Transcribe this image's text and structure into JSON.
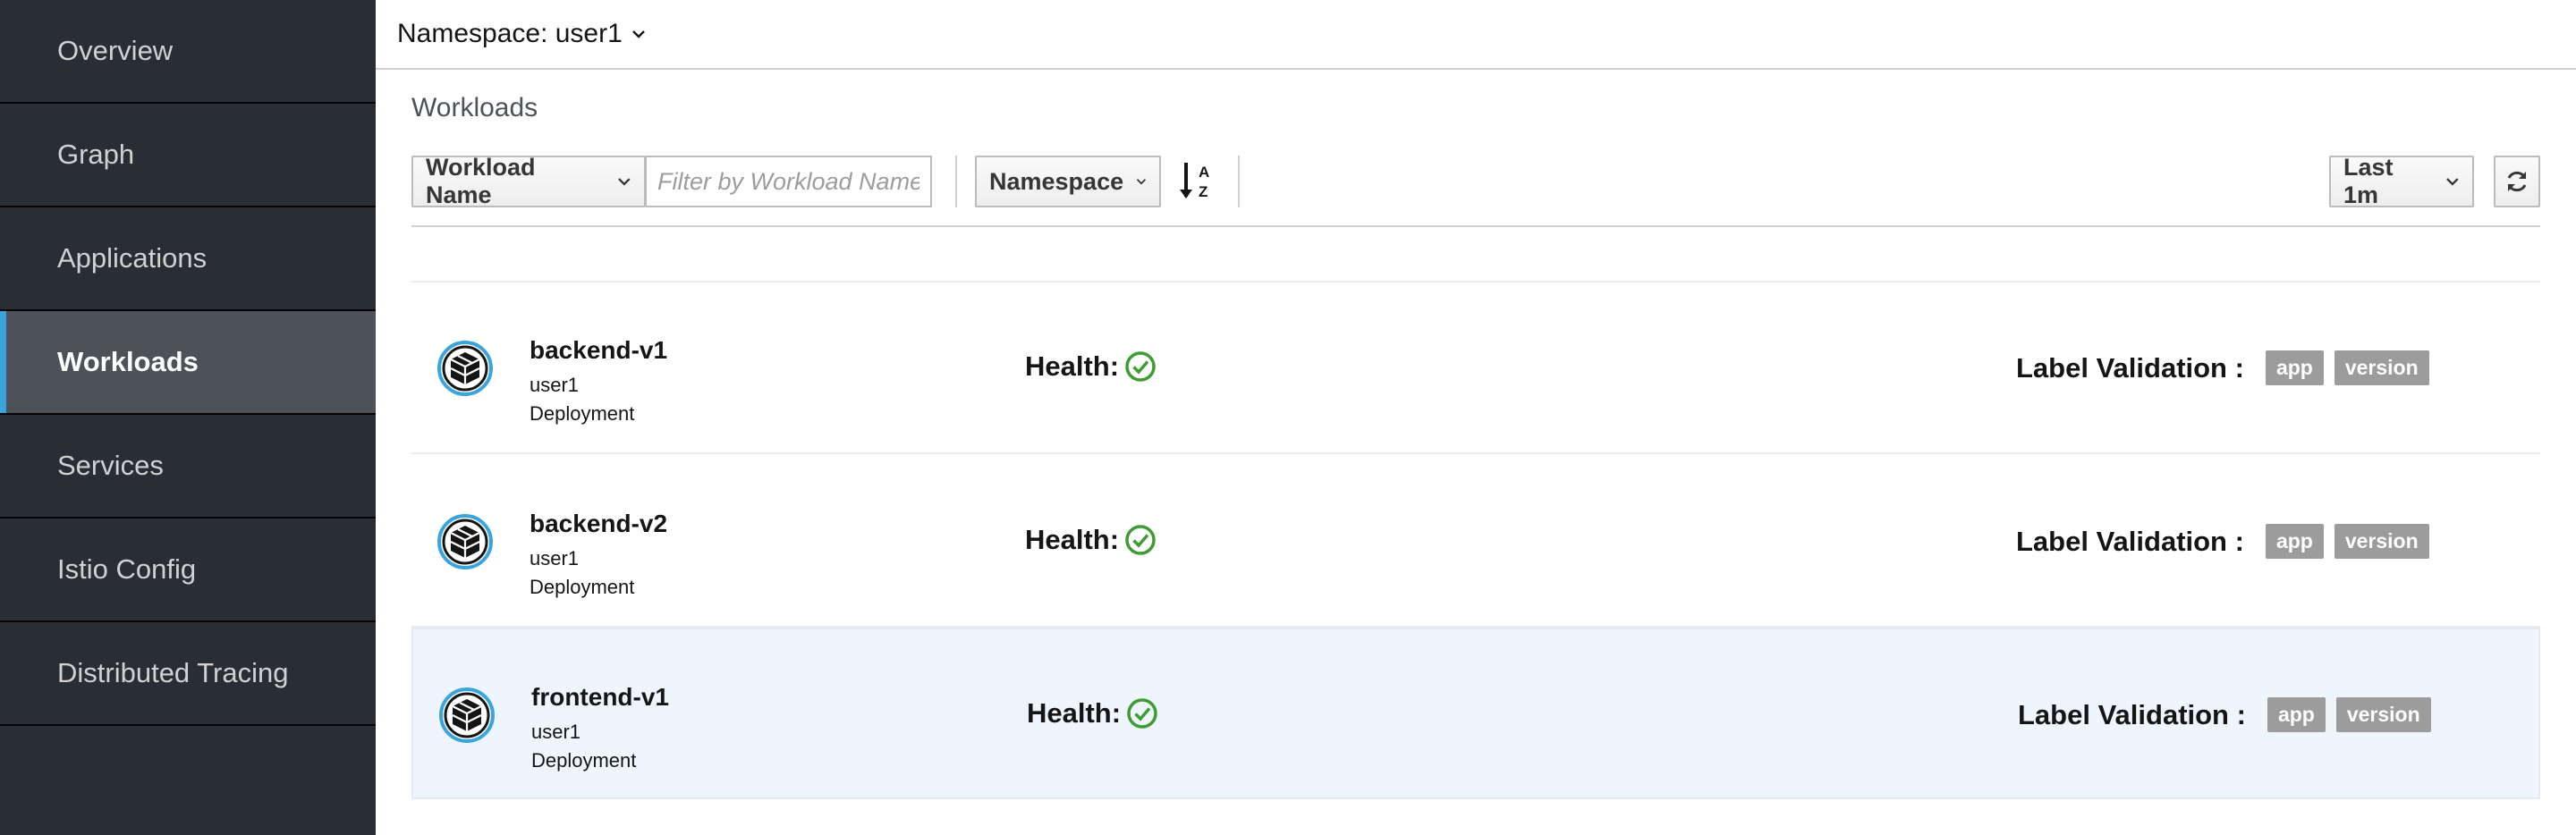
{
  "sidebar": {
    "items": [
      {
        "label": "Overview",
        "active": false
      },
      {
        "label": "Graph",
        "active": false
      },
      {
        "label": "Applications",
        "active": false
      },
      {
        "label": "Workloads",
        "active": true
      },
      {
        "label": "Services",
        "active": false
      },
      {
        "label": "Istio Config",
        "active": false
      },
      {
        "label": "Distributed Tracing",
        "active": false
      }
    ],
    "active_accent": "#39a5dc"
  },
  "namespace_selector": {
    "label": "Namespace: user1",
    "icon": "chevron-down-icon"
  },
  "page": {
    "title": "Workloads"
  },
  "toolbar": {
    "filter_type": "Workload Name",
    "filter_placeholder": "Filter by Workload Name",
    "sort_field": "Namespace",
    "sort_icon": "sort-alpha-asc-icon",
    "time_range": "Last 1m",
    "refresh_icon": "refresh-icon"
  },
  "workloads": [
    {
      "name": "backend-v1",
      "namespace": "user1",
      "type": "Deployment",
      "health_label": "Health:",
      "health_status": "healthy",
      "label_validation_label": "Label Validation :",
      "labels": [
        "app",
        "version"
      ],
      "selected": false
    },
    {
      "name": "backend-v2",
      "namespace": "user1",
      "type": "Deployment",
      "health_label": "Health:",
      "health_status": "healthy",
      "label_validation_label": "Label Validation :",
      "labels": [
        "app",
        "version"
      ],
      "selected": false
    },
    {
      "name": "frontend-v1",
      "namespace": "user1",
      "type": "Deployment",
      "health_label": "Health:",
      "health_status": "healthy",
      "label_validation_label": "Label Validation :",
      "labels": [
        "app",
        "version"
      ],
      "selected": true
    }
  ],
  "colors": {
    "healthy": "#3f9c35",
    "badge": "#9c9c9c",
    "workload_icon_ring": "#39a5dc",
    "selected_row": "#eef5fc"
  }
}
